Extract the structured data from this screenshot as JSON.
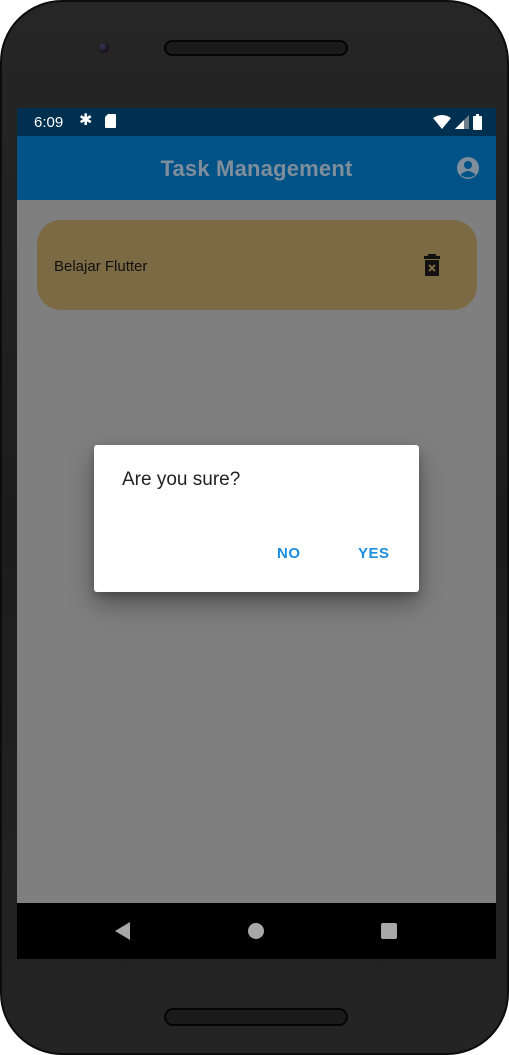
{
  "status_bar": {
    "time": "6:09",
    "icons": [
      "gear-icon",
      "sd-card-icon",
      "wifi-icon",
      "signal-icon",
      "battery-icon"
    ]
  },
  "app_bar": {
    "title": "Task Management",
    "account_icon": "account-circle-icon"
  },
  "tasks": [
    {
      "label": "Belajar Flutter",
      "icon": "delete-forever-icon"
    }
  ],
  "dialog": {
    "message": "Are you sure?",
    "no_label": "NO",
    "yes_label": "YES"
  },
  "fab": {
    "symbol": "+"
  },
  "nav_bar": {
    "icons": [
      "back-icon",
      "home-icon",
      "recents-icon"
    ]
  },
  "colors": {
    "status_bar": "#00304f",
    "app_bar": "#015286",
    "scrim_background": "#7f7f7f",
    "task_card": "#7b6a43",
    "dialog_button": "#1b8ee0",
    "fab": "#01508a"
  }
}
